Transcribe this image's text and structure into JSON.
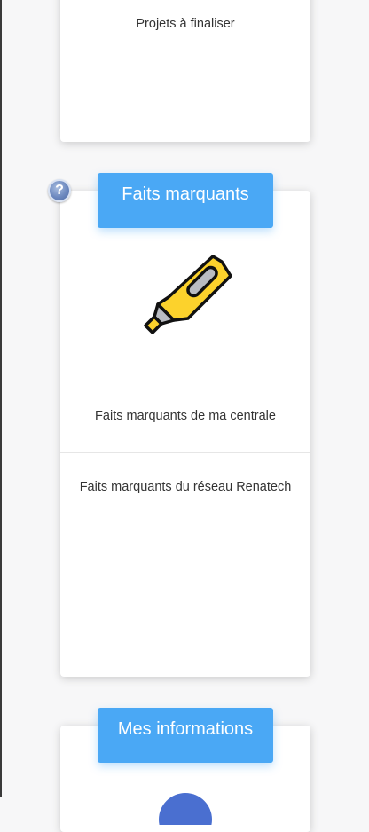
{
  "projects_card": {
    "link_label": "Projets à finaliser"
  },
  "highlights_card": {
    "header": "Faits marquants",
    "help_symbol": "?",
    "icon": "highlighter-marker-icon",
    "links": [
      "Faits marquants de ma centrale",
      "Faits marquants du réseau Renatech"
    ]
  },
  "info_card": {
    "header": "Mes informations",
    "icon": "user-avatar-icon"
  },
  "colors": {
    "accent": "#4aa8f5",
    "marker_yellow": "#fcd22c",
    "marker_grey": "#b9bcc2",
    "help_icon_blue": "#6d89bf"
  }
}
